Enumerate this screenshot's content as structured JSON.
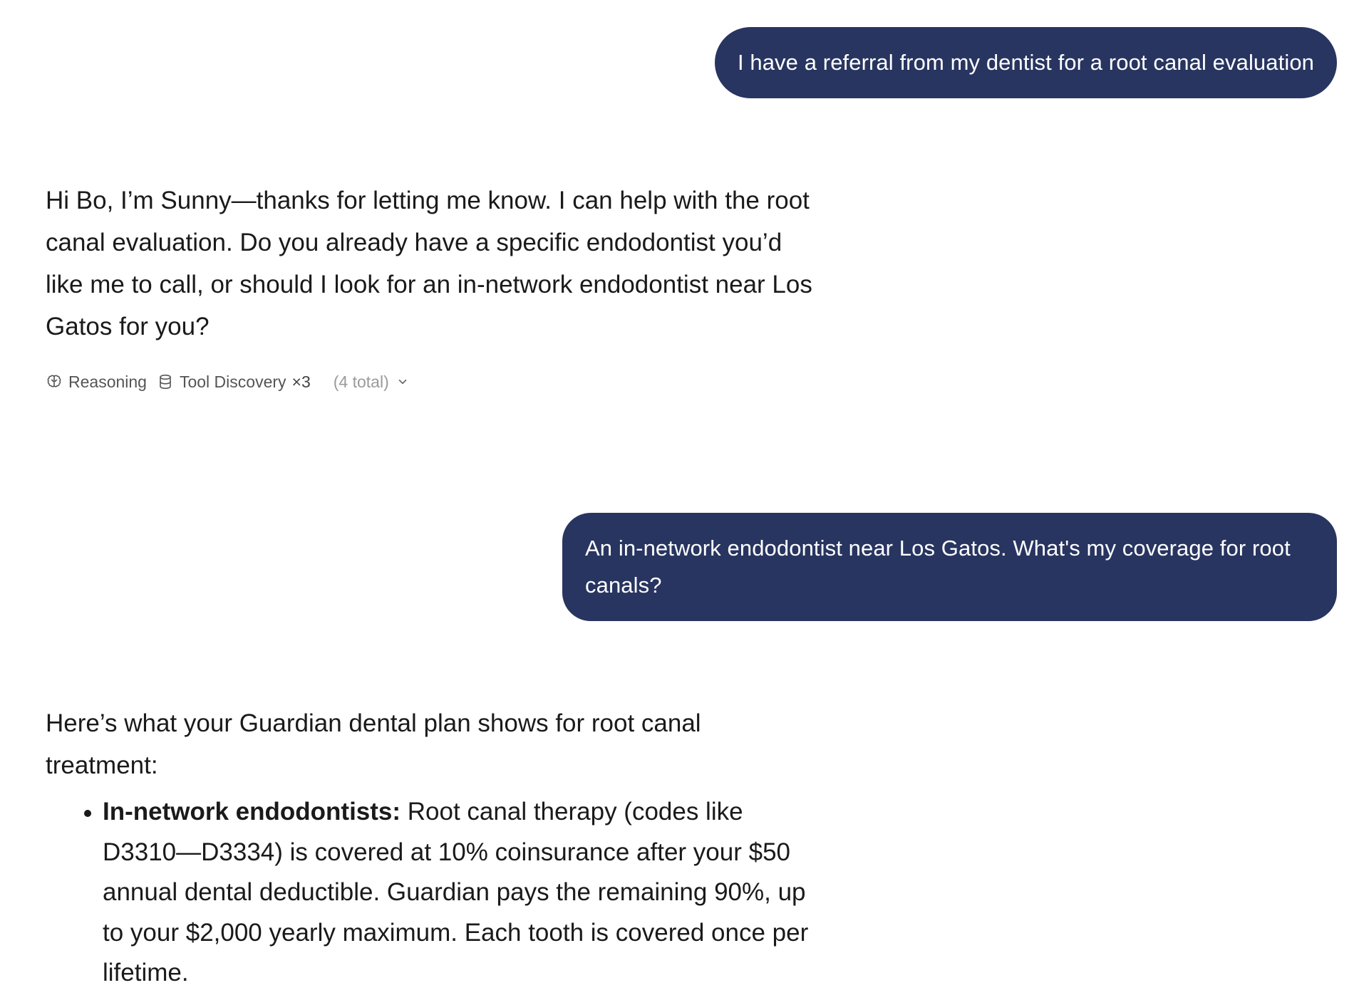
{
  "conversation": {
    "user_message_1": "I have a referral from my dentist for a root canal evaluation",
    "assistant_message_1": "Hi Bo, I’m Sunny—thanks for letting me know. I can help with the root canal evaluation. Do you already have a specific endodontist you’d like me to call, or should I look for an in-network endodontist near Los Gatos for you?",
    "meta": {
      "reasoning_label": "Reasoning",
      "reasoning_icon": "brain-icon",
      "tool_label": "Tool Discovery",
      "tool_icon": "database-icon",
      "tool_count": "×3",
      "total_label": "(4 total)",
      "expand_icon": "chevron-down-icon"
    },
    "user_message_2": "An in-network endodontist near Los Gatos. What's my coverage for root canals?",
    "assistant_message_2": {
      "intro": "Here’s what your Guardian dental plan shows for root canal treatment:",
      "bullets": [
        {
          "bold": "In-network endodontists:",
          "text": " Root canal therapy (codes like D3310—D3334) is covered at 10% coinsurance after your $50 annual dental deductible. Guardian pays the remaining 90%, up to your $2,000 yearly maximum. Each tooth is covered once per lifetime."
        }
      ]
    }
  },
  "colors": {
    "user_bubble": "#283560",
    "user_text": "#ffffff",
    "assistant_text": "#1a1a1a",
    "meta_text": "#555555",
    "meta_muted": "#9a9a9a"
  }
}
